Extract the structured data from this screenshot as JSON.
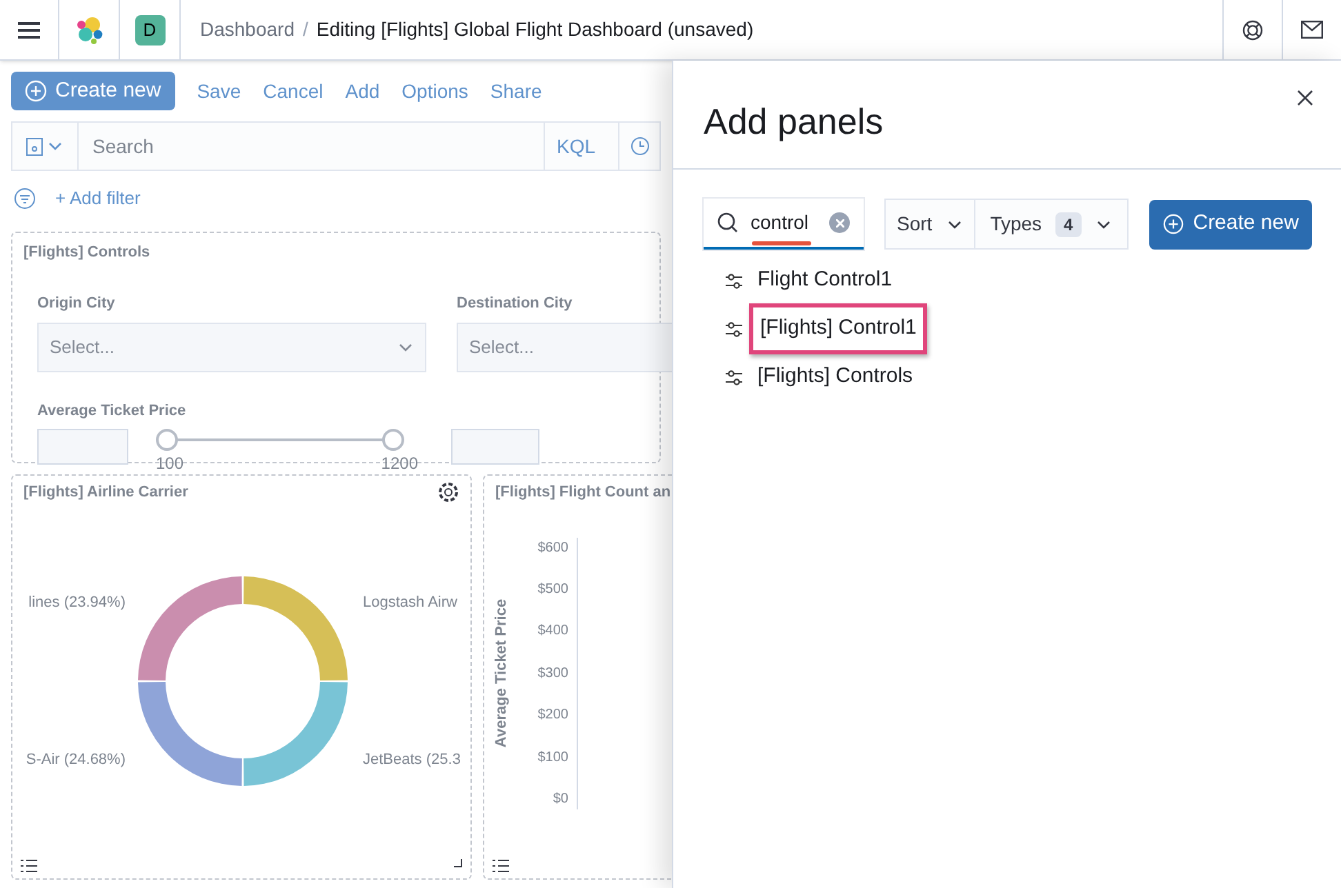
{
  "header": {
    "breadcrumbs": [
      {
        "label": "Dashboard"
      },
      {
        "label": "Editing [Flights] Global Flight Dashboard (unsaved)"
      }
    ],
    "separator": "/",
    "avatar": "D"
  },
  "toolbar": {
    "primary": "Create new",
    "links": [
      "Save",
      "Cancel",
      "Add",
      "Options",
      "Share"
    ]
  },
  "query_bar": {
    "placeholder": "Search",
    "language": "KQL"
  },
  "add_filter": "+ Add filter",
  "controls_panel": {
    "title": "[Flights] Controls",
    "fields": [
      {
        "label": "Origin City",
        "placeholder": "Select..."
      },
      {
        "label": "Destination City",
        "placeholder": "Select..."
      }
    ],
    "range": {
      "label": "Average Ticket Price",
      "min": "100",
      "max": "1200",
      "level": 1
    }
  },
  "carrier_panel": {
    "title": "[Flights] Airline Carrier",
    "left_labels": [
      "lines (23.94%)",
      "S-Air (24.68%)"
    ],
    "right_labels": [
      "Logstash Airw",
      "JetBeats (25.3"
    ],
    "slices": [
      {
        "color": "#d6bf57"
      },
      {
        "color": "#79c4d6"
      },
      {
        "color": "#8fa4d8"
      },
      {
        "color": "#ca8eae"
      }
    ]
  },
  "count_panel": {
    "title": "[Flights] Flight Count an",
    "ylabel": "Average Ticket Price",
    "yticks": [
      "$600",
      "$500",
      "$400",
      "$300",
      "$200",
      "$100",
      "$0"
    ]
  },
  "flyout": {
    "title": "Add panels",
    "search": {
      "value": "control",
      "marked": true
    },
    "sort": "Sort",
    "types": {
      "label": "Types",
      "count": "4"
    },
    "create": "Create new",
    "results": [
      {
        "label": "Flight Control1",
        "highlighted": false
      },
      {
        "label": "[Flights] Control1",
        "highlighted": true
      },
      {
        "label": "[Flights] Controls",
        "highlighted": false
      }
    ]
  }
}
